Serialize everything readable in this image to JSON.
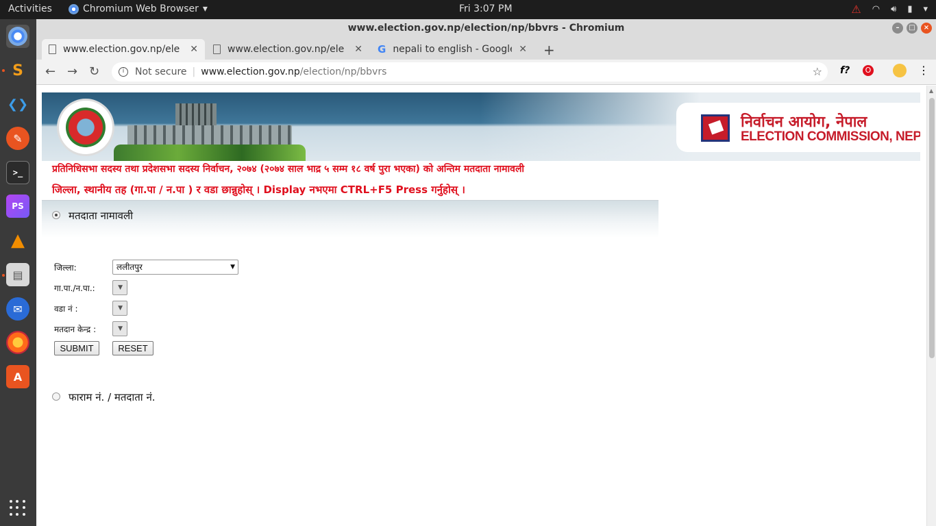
{
  "topbar": {
    "activities": "Activities",
    "app_name": "Chromium Web Browser",
    "clock": "Fri  3:07 PM"
  },
  "window": {
    "title": "www.election.gov.np/election/np/bbvrs - Chromium"
  },
  "tabs": [
    {
      "title": "www.election.gov.np/ele",
      "icon": "page-icon",
      "active": true
    },
    {
      "title": "www.election.gov.np/ele",
      "icon": "page-icon",
      "active": false
    },
    {
      "title": "nepali to english - Google",
      "icon": "google-icon",
      "active": false
    }
  ],
  "omnibox": {
    "security": "Not secure",
    "host": "www.election.gov.np",
    "path": "/election/np/bbvrs"
  },
  "header": {
    "logo_np": "निर्वाचन आयोग, नेपाल",
    "logo_en": "ELECTION COMMISSION, NEPAL"
  },
  "notice": {
    "line1": "प्रतिनिधिसभा सदस्य तथा प्रदेशसभा सदस्य निर्वाचन, २०७४ (२०७४ साल भाद्र ५ सम्म १८ वर्ष पुरा भएका) को अन्तिम मतदाता नामावली",
    "line2": "जिल्ला, स्थानीय तह (गा.पा / न.पा ) र वडा छान्नुहोस् । Display नभएमा CTRL+F5 Press गर्नुहोस् ।"
  },
  "form": {
    "option1_label": "मतदाता नामावली",
    "option2_label": "फाराम नं. / मतदाता नं.",
    "district_label": "जिल्ला:",
    "district_value": "ललीतपुर",
    "local_label": "गा.पा./न.पा.:",
    "ward_label": "वडा नं :",
    "center_label": "मतदान केन्द्र :",
    "submit": "SUBMIT",
    "reset": "RESET"
  },
  "colors": {
    "accent_red": "#e0101e",
    "ubuntu_orange": "#e95420",
    "banner_blue": "#2a5a7a"
  }
}
